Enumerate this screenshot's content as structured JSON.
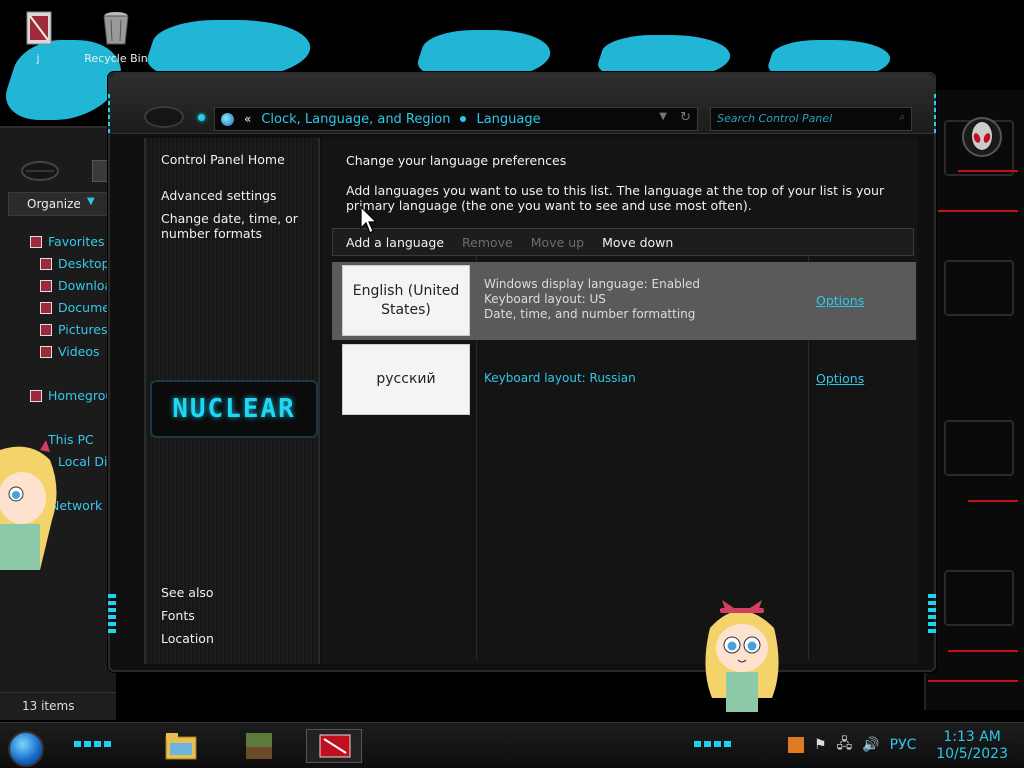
{
  "desktop": {
    "icons": [
      {
        "label": "j"
      },
      {
        "label": "Recycle Bin"
      }
    ]
  },
  "explorer": {
    "organize_label": "Organize",
    "nav_items": [
      {
        "label": "Favorites"
      },
      {
        "label": "Desktop"
      },
      {
        "label": "Downloa"
      },
      {
        "label": "Documen"
      },
      {
        "label": "Pictures"
      },
      {
        "label": "Videos"
      },
      {
        "label": "Homegroup"
      },
      {
        "label": "This PC"
      },
      {
        "label": "Local Dis"
      },
      {
        "label": "Network"
      }
    ],
    "status": "13 items"
  },
  "control_panel": {
    "breadcrumb": {
      "back_chevrons": "«",
      "parent": "Clock, Language, and Region",
      "current": "Language"
    },
    "search_placeholder": "Search Control Panel",
    "left_pane": {
      "home": "Control Panel Home",
      "advanced": "Advanced settings",
      "date_time": "Change date, time, or number formats",
      "banner": "NUCLEAR",
      "see_also": "See also",
      "fonts": "Fonts",
      "location": "Location"
    },
    "main": {
      "title": "Change your language preferences",
      "description": "Add languages you want to use to this list. The language at the top of your list is your primary language (the one you want to see and use most often).",
      "toolbar": {
        "add": "Add a language",
        "remove": "Remove",
        "move_up": "Move up",
        "move_down": "Move down"
      },
      "languages": [
        {
          "name": "English (United States)",
          "info_1": "Windows display language: Enabled",
          "info_2": "Keyboard layout: US",
          "info_3": "Date, time, and number formatting",
          "options": "Options"
        },
        {
          "name": "русский",
          "info_1": "Keyboard layout: Russian",
          "options": "Options"
        }
      ]
    }
  },
  "taskbar": {
    "input_language": "РУС",
    "time": "1:13 AM",
    "date": "10/5/2023"
  },
  "colors": {
    "accent": "#2fc7e8",
    "selected_row": "#5a5a5a",
    "window_bg": "#141414"
  }
}
